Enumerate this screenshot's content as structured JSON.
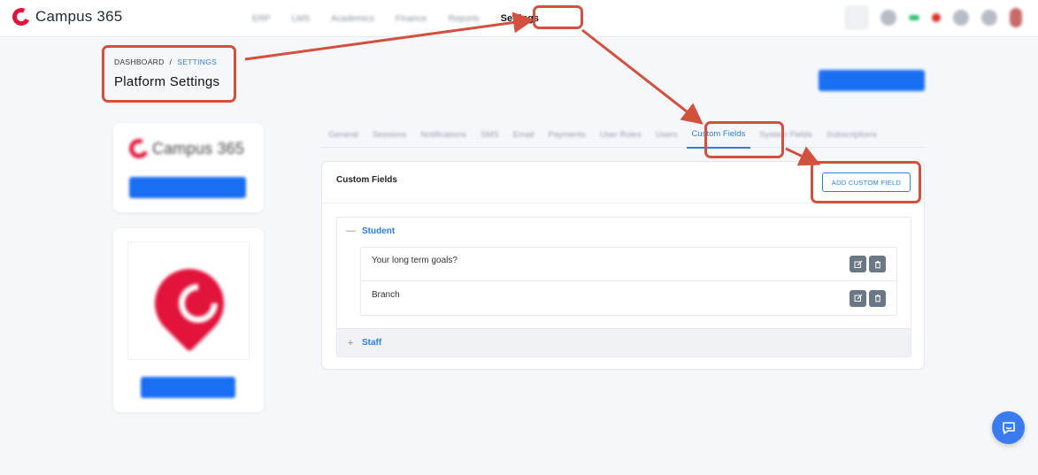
{
  "app": {
    "logo_text": "Campus 365"
  },
  "topnav": {
    "items": [
      "ERP",
      "LMS",
      "Academics",
      "Finance",
      "Reports"
    ],
    "settings_label": "Settings"
  },
  "breadcrumb": {
    "root": "DASHBOARD",
    "separator": "/",
    "current": "SETTINGS"
  },
  "page": {
    "title": "Platform Settings"
  },
  "tabs": [
    "General",
    "Sessions",
    "Notifications",
    "SMS",
    "Email",
    "Payments",
    "User Roles",
    "Users",
    "Custom Fields",
    "System Fields",
    "Subscriptions"
  ],
  "active_tab": "Custom Fields",
  "card": {
    "title": "Custom Fields",
    "add_button": "ADD CUSTOM FIELD"
  },
  "sections": [
    {
      "name": "Student",
      "expanded_sign": "—",
      "fields": [
        "Your long term goals?",
        "Branch"
      ]
    },
    {
      "name": "Staff",
      "collapsed_sign": "+"
    }
  ],
  "icons": {
    "edit": "edit-icon",
    "delete": "trash-icon",
    "chat": "chat-icon"
  },
  "colors": {
    "accent": "#2f7fd8",
    "brand": "#e2143c",
    "annotation": "#d2503e"
  }
}
